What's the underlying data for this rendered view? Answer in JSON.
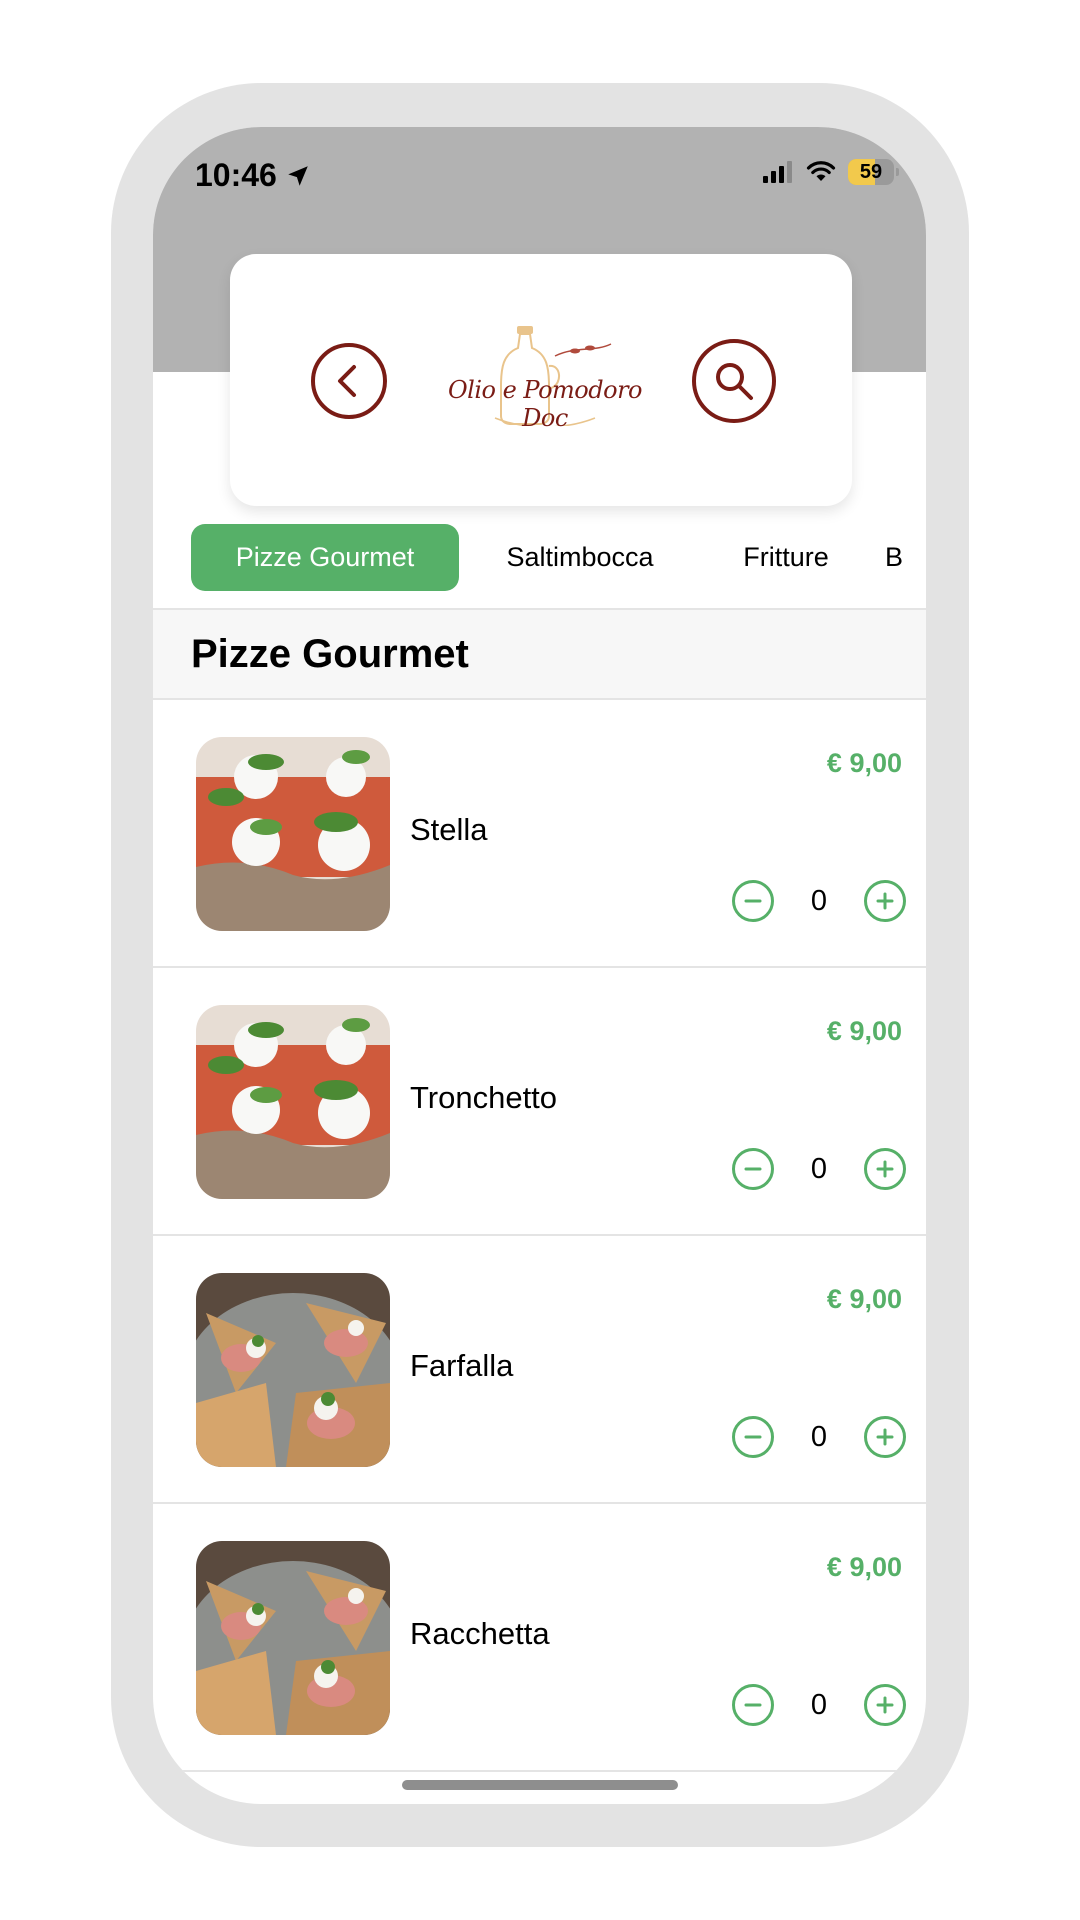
{
  "status_bar": {
    "time": "10:46",
    "battery": "59",
    "battery_percent": 59,
    "icons": [
      "location-arrow-icon",
      "cellular-signal-icon",
      "wifi-icon",
      "battery-icon"
    ]
  },
  "header": {
    "brand": "Olio e Pomodoro Doc",
    "back_icon": "chevron-left-icon",
    "search_icon": "search-icon",
    "brand_color": "#7a1c15"
  },
  "categories": {
    "items": [
      "Pizze Gourmet",
      "Saltimbocca",
      "Fritture",
      "B"
    ],
    "active": "Pizze Gourmet"
  },
  "section": {
    "title": "Pizze Gourmet"
  },
  "products": [
    {
      "name": "Stella",
      "price": "€ 9,00",
      "quantity": "0"
    },
    {
      "name": "Tronchetto",
      "price": "€ 9,00",
      "quantity": "0"
    },
    {
      "name": "Farfalla",
      "price": "€ 9,00",
      "quantity": "0"
    },
    {
      "name": "Racchetta",
      "price": "€ 9,00",
      "quantity": "0"
    }
  ],
  "colors": {
    "accent": "#56b068",
    "brand": "#7a1c15",
    "header_bg": "#b2b2b2"
  }
}
